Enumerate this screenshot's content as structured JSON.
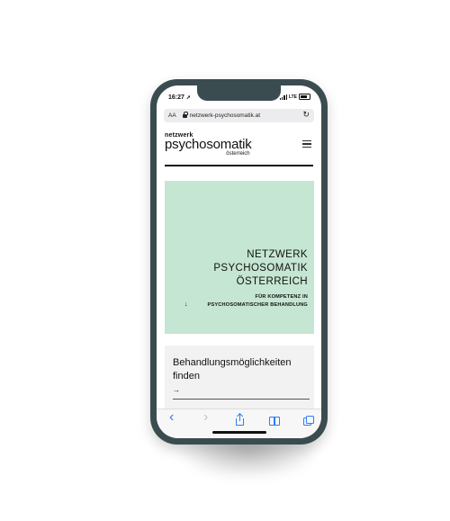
{
  "status_bar": {
    "time": "16:27",
    "location_glyph": "➚",
    "network": "LTE"
  },
  "browser": {
    "text_size_label": "AA",
    "url": "netzwerk-psychosomatik.at"
  },
  "site_header": {
    "logo_line1": "netzwerk",
    "logo_line2": "psychosomatik",
    "logo_line3": "österreich"
  },
  "hero": {
    "title_lines": [
      "NETZWERK",
      "PSYCHOSOMATIK",
      "ÖSTERREICH"
    ],
    "subtitle_lines": [
      "FÜR KOMPETENZ IN",
      "PSYCHOSOMATISCHER BEHANDLUNG"
    ],
    "arrow": "↓",
    "background_color": "#c5e6d2"
  },
  "card": {
    "title_lines": [
      "Behandlungsmöglichkeiten",
      "finden"
    ],
    "arrow": "→"
  },
  "toolbar": {
    "back": "‹",
    "forward": "›"
  },
  "colors": {
    "phone_frame": "#3b4c50",
    "ios_blue": "#2d7df6"
  }
}
